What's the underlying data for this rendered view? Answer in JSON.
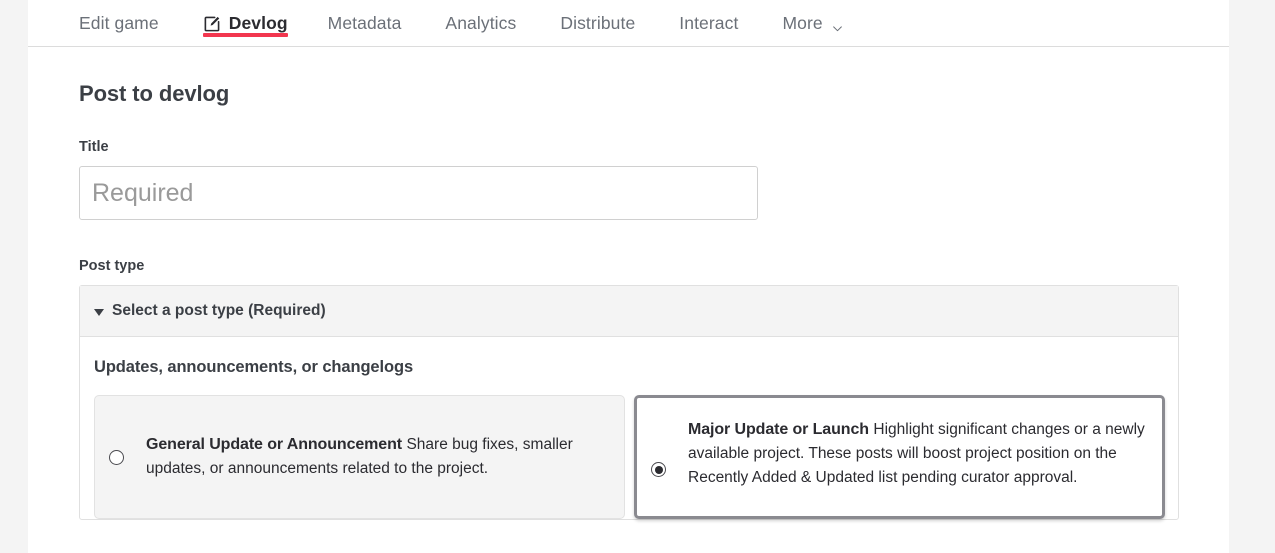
{
  "tabs": [
    {
      "label": "Edit game",
      "icon": null,
      "active": false
    },
    {
      "label": "Devlog",
      "icon": "edit-pencil-square-icon",
      "active": true
    },
    {
      "label": "Metadata",
      "icon": null,
      "active": false
    },
    {
      "label": "Analytics",
      "icon": null,
      "active": false
    },
    {
      "label": "Distribute",
      "icon": null,
      "active": false
    },
    {
      "label": "Interact",
      "icon": null,
      "active": false
    }
  ],
  "more_tab": {
    "label": "More",
    "icon": "chevron-down-icon"
  },
  "colors": {
    "active_tab_underline": "#f2364f",
    "page_background": "#f4f4f4",
    "content_background": "#ffffff",
    "selected_card_border": "#8a8a90",
    "text_primary": "#3b3f45",
    "text_muted": "#6b7078"
  },
  "main": {
    "page_title": "Post to devlog",
    "title_field": {
      "label": "Title",
      "value": "",
      "placeholder": "Required"
    },
    "post_type": {
      "label": "Post type",
      "disclosure_header": "Select a post type (Required)",
      "expanded": true,
      "group_title": "Updates, announcements, or changelogs",
      "options": [
        {
          "title": "General Update or Announcement",
          "description": "Share bug fixes, smaller updates, or announcements related to the project.",
          "selected": false
        },
        {
          "title": "Major Update or Launch",
          "description": "Highlight significant changes or a newly available project. These posts will boost project position on the Recently Added & Updated list pending curator approval.",
          "selected": true
        }
      ]
    }
  }
}
